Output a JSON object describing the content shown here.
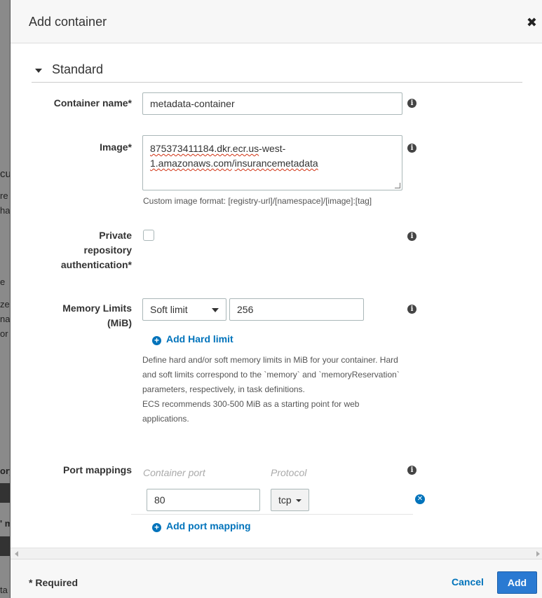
{
  "modal": {
    "title": "Add container",
    "close_icon": "close-icon"
  },
  "section": {
    "title": "Standard",
    "expanded": true
  },
  "fields": {
    "container_name": {
      "label": "Container name*",
      "value": "metadata-container"
    },
    "image": {
      "label": "Image*",
      "value_line1_a": "875373411184.dkr.ecr.us",
      "value_line1_b": "-west-",
      "value_line2_a": "1.amazonaws.com",
      "value_line2_b": "/",
      "value_line2_c": "insurancemetadata",
      "hint": "Custom image format: [registry-url]/[namespace]/[image]:[tag]"
    },
    "private_repo": {
      "label_line1": "Private",
      "label_line2": "repository",
      "label_line3": "authentication*",
      "checked": false
    },
    "memory": {
      "label_line1": "Memory Limits",
      "label_line2": "(MiB)",
      "limit_type": "Soft limit",
      "value": "256",
      "add_hard_limit": "Add Hard limit",
      "help_line1": "Define hard and/or soft memory limits in MiB for your container. Hard",
      "help_line2": "and soft limits correspond to the `memory` and `memoryReservation`",
      "help_line3": "parameters, respectively, in task definitions.",
      "help_line4": "ECS recommends 300-500 MiB as a starting point for web",
      "help_line5": "applications."
    },
    "port_mappings": {
      "label": "Port mappings",
      "col_container_port": "Container port",
      "col_protocol": "Protocol",
      "rows": [
        {
          "container_port": "80",
          "protocol": "tcp"
        }
      ],
      "add_port_mapping": "Add port mapping"
    }
  },
  "background_page": {
    "frags": [
      "cu",
      "re",
      "ha",
      "e",
      "ze",
      "na",
      "or",
      "ory",
      "' m",
      "ta"
    ]
  },
  "footer": {
    "required_note": "* Required",
    "cancel_label": "Cancel",
    "add_label": "Add"
  },
  "colors": {
    "link": "#0073bb",
    "primary_button": "#2a7ad2",
    "border": "#aab7b8"
  }
}
